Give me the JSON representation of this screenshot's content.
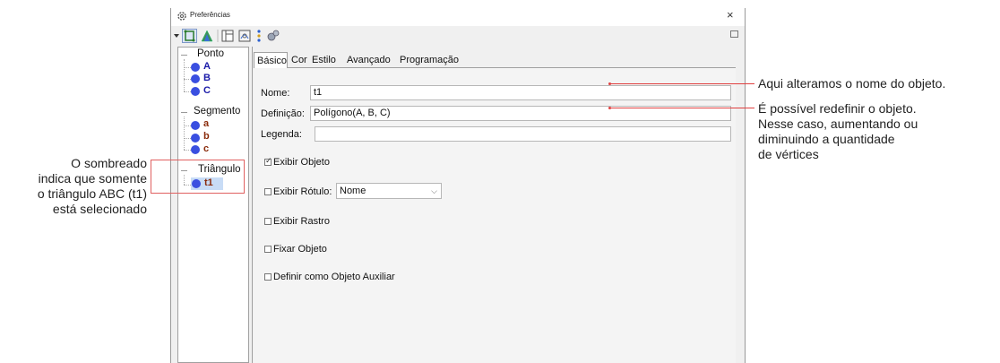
{
  "window": {
    "title": "Preferências"
  },
  "tree": {
    "groups": [
      {
        "label": "Ponto",
        "items": [
          {
            "label": "A",
            "color": "#1a1aa8"
          },
          {
            "label": "B",
            "color": "#1a1aa8"
          },
          {
            "label": "C",
            "color": "#1a1aa8"
          }
        ]
      },
      {
        "label": "Segmento",
        "items": [
          {
            "label": "a",
            "color": "#8a2b0b"
          },
          {
            "label": "b",
            "color": "#8a2b0b"
          },
          {
            "label": "c",
            "color": "#8a2b0b"
          }
        ]
      },
      {
        "label": "Triângulo",
        "items": [
          {
            "label": "t1",
            "color": "#8a2b0b",
            "selected": true
          }
        ]
      }
    ]
  },
  "tabs": [
    "Básico",
    "Cor",
    "Estilo",
    "Avançado",
    "Programação"
  ],
  "form": {
    "name_label": "Nome:",
    "name_value": "t1",
    "definition_label": "Definição:",
    "definition_value": "Polígono(A, B, C)",
    "caption_label": "Legenda:",
    "caption_value": "",
    "show_object": "Exibir Objeto",
    "show_label": "Exibir Rótulo:",
    "label_select": "Nome",
    "show_trace": "Exibir Rastro",
    "fix_object": "Fixar Objeto",
    "auxiliary": "Definir como Objeto Auxiliar"
  },
  "annotations": {
    "left": [
      "O sombreado",
      "indica que somente",
      "o triângulo ABC (t1)",
      "está selecionado"
    ],
    "name": "Aqui alteramos o nome do objeto.",
    "definition": [
      "É possível redefinir o objeto.",
      "Nesse caso, aumentando ou",
      "diminuindo a quantidade",
      "de vértices"
    ]
  },
  "colors": {
    "accent": "#e04040",
    "point_blue": "#3a4fe0",
    "selection": "#c8dcf6"
  },
  "icons": [
    "gear-icon",
    "move-tool-icon",
    "triangle-tool-icon",
    "layout-icon",
    "graphics-icon",
    "dots-icon",
    "settings-icon",
    "dock-icon",
    "close-icon"
  ]
}
